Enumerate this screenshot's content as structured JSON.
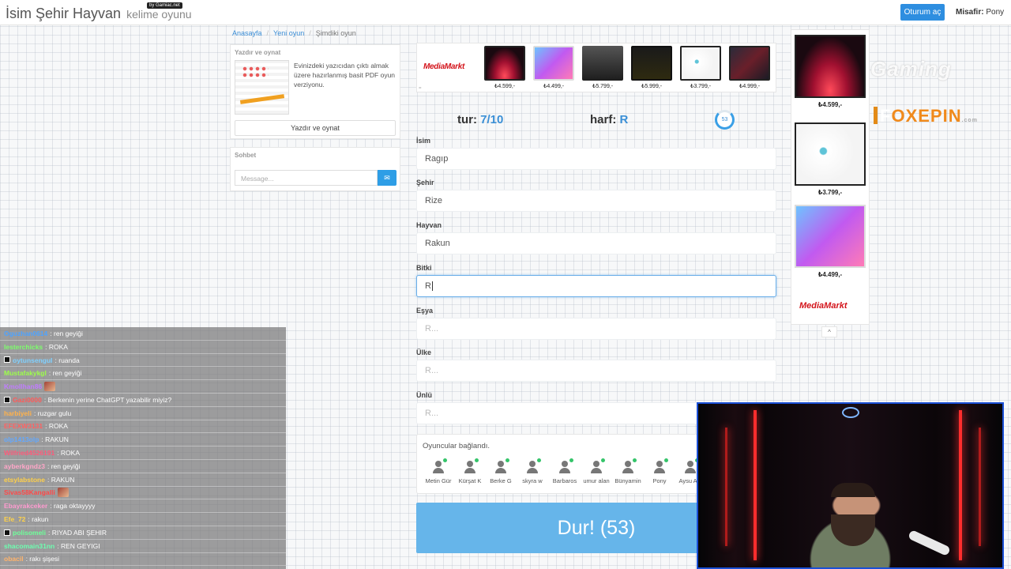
{
  "header": {
    "title": "İsim Şehir Hayvan",
    "subtitle": "kelime oyunu",
    "by_badge": "by Gamiac.net",
    "login_label": "Oturum aç",
    "guest_label": "Misafir:",
    "guest_name": "Pony"
  },
  "breadcrumb": {
    "home": "Anasayfa",
    "new_game": "Yeni oyun",
    "current": "Şimdiki oyun"
  },
  "print_panel": {
    "title": "Yazdır ve oynat",
    "description": "Evinizdeki yazıcıdan çıktı almak üzere hazırlanmış basit PDF oyun verziyonu.",
    "button": "Yazdır ve oynat"
  },
  "chat_panel": {
    "title": "Sohbet",
    "placeholder": "Message..."
  },
  "ad_strip": {
    "brand": "MediaMarkt",
    "prices": [
      "₺4.599,-",
      "₺4.499,-",
      "₺5.799,-",
      "₺5.999,-",
      "₺3.799,-",
      "₺4.999,-"
    ]
  },
  "game": {
    "round_label": "tur:",
    "round_value": "7/10",
    "letter_label": "harf:",
    "letter_value": "R",
    "timer": "53"
  },
  "fields": [
    {
      "label": "İsim",
      "value": "Ragıp",
      "placeholder": ""
    },
    {
      "label": "Şehir",
      "value": "Rize",
      "placeholder": ""
    },
    {
      "label": "Hayvan",
      "value": "Rakun",
      "placeholder": ""
    },
    {
      "label": "Bitki",
      "value": "R",
      "placeholder": ""
    },
    {
      "label": "Eşya",
      "value": "",
      "placeholder": "R..."
    },
    {
      "label": "Ülke",
      "value": "",
      "placeholder": "R..."
    },
    {
      "label": "Ünlü",
      "value": "",
      "placeholder": "R..."
    }
  ],
  "players": {
    "status": "Oyuncular bağlandı.",
    "list": [
      "Metin Gür",
      "Kürşat K",
      "Berke G",
      "skyra w",
      "Barbaros",
      "umur alan",
      "Bünyamin",
      "Pony",
      "Aysu Alp"
    ]
  },
  "stop_button": "Dur! (53)",
  "side_ad": {
    "prices": [
      "₺4.599,-",
      "₺3.799,-",
      "₺4.499,-"
    ],
    "brand": "MediaMarkt"
  },
  "overlay_logos": {
    "logo_a": "Gaming",
    "logo_b_prefix": "F",
    "logo_b_accent": "OXEPIN",
    "logo_b_suffix": ".com"
  },
  "twitch_chat": [
    {
      "user": "Oguzhan0614",
      "color": "#4da3ff",
      "msg": ": ren geyiği"
    },
    {
      "user": "lesterchicks",
      "color": "#7dff6b",
      "msg": ": ROKA"
    },
    {
      "user": "oytunsengul",
      "color": "#7fd0ff",
      "msg": ": ruanda"
    },
    {
      "user": "Mustafakykgl",
      "color": "#9dff4a",
      "msg": ": ren geyiği"
    },
    {
      "user": "Kmollhan86",
      "color": "#c07bff",
      "msg": ""
    },
    {
      "user": "Gazi0000",
      "color": "#ff5a5a",
      "msg": ": Berkenin yerine ChatGPT yazabilir miyiz?"
    },
    {
      "user": "harbiyeli",
      "color": "#ffb14a",
      "msg": ": ruzgar gulu"
    },
    {
      "user": "EFEXW3131",
      "color": "#ff6262",
      "msg": ": ROKA"
    },
    {
      "user": "olp1413olp",
      "color": "#62a8ff",
      "msg": ": RAKUN"
    },
    {
      "user": "Wilfried4526191",
      "color": "#ff5a7a",
      "msg": ": ROKA"
    },
    {
      "user": "ayberkgndz3",
      "color": "#ffa6c8",
      "msg": ": ren geyiği"
    },
    {
      "user": "etsylabstone",
      "color": "#ffd04a",
      "msg": ": RAKUN"
    },
    {
      "user": "Sivas58Kangalli",
      "color": "#ff4848",
      "msg": ""
    },
    {
      "user": "Ebayrakceker",
      "color": "#ff9bd0",
      "msg": ": raga oktayyyy"
    },
    {
      "user": "Efe_72",
      "color": "#ffd24a",
      "msg": ": rakun"
    },
    {
      "user": "polisomeli",
      "color": "#6dff9a",
      "msg": ": RIYAD ABI ŞEHIR"
    },
    {
      "user": "shacomain31nn",
      "color": "#6dffb0",
      "msg": ": REN GEYIGI"
    },
    {
      "user": "obacil",
      "color": "#ffb36b",
      "msg": ": rakı şişesi"
    }
  ]
}
